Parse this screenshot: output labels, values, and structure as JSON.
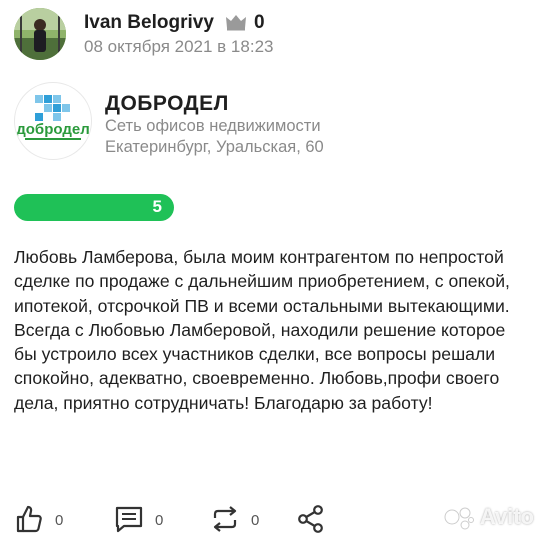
{
  "post": {
    "author": "Ivan Belogrivy",
    "crown_count": "0",
    "date": "08 октября 2021 в 18:23"
  },
  "organization": {
    "name": "ДОБРОДЕЛ",
    "description": "Сеть офисов недвижимости",
    "address": "Екатеринбург, Уральская, 60",
    "logo_text": "добродел"
  },
  "rating": {
    "value": "5",
    "fill": 1.0,
    "color": "#1fc157"
  },
  "review": {
    "text": "Любовь Ламберова, была моим контрагентом по непростой сделке по продаже с дальнейшим приобретением, с опекой, ипотекой, отсрочкой ПВ и всеми остальными вытекающими. Всегда с Любовью Ламберовой, находили решение которое бы устроило всех участников сделки, все вопросы решали спокойно, адекватно, своевременно. Любовь,профи своего дела, приятно сотрудничать! Благодарю за работу!"
  },
  "actions": {
    "likes": "0",
    "comments": "0",
    "reposts": "0"
  },
  "watermark": "Avito"
}
